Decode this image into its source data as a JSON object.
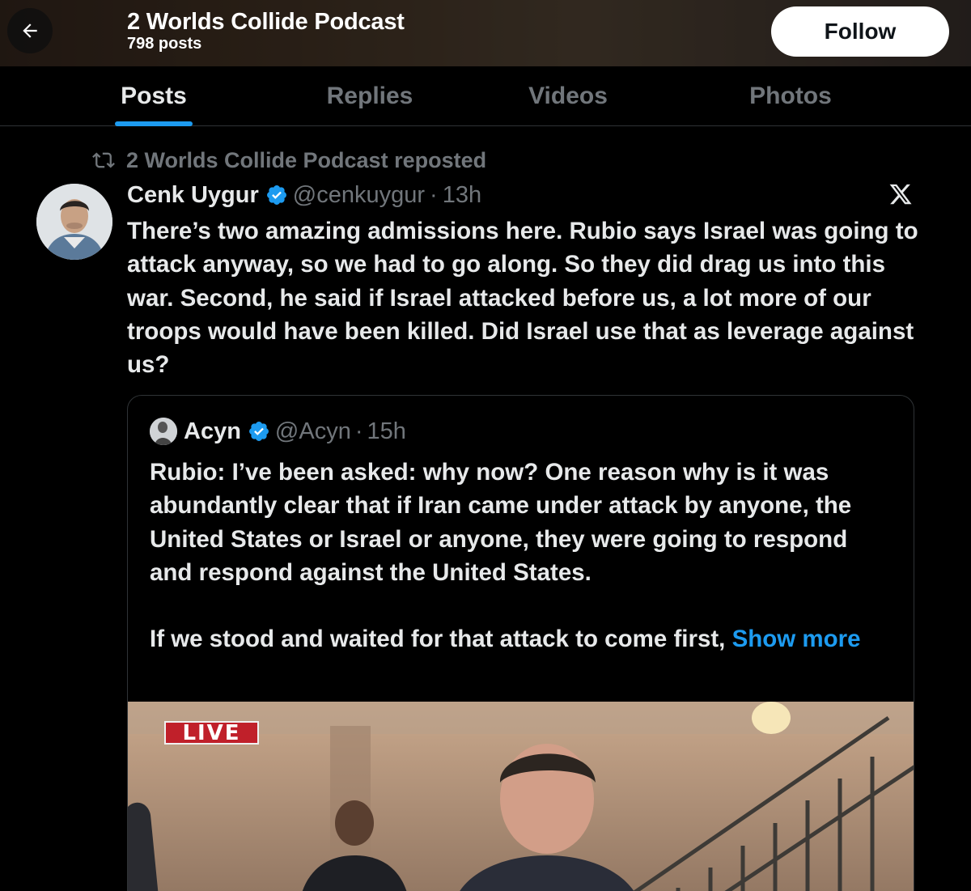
{
  "header": {
    "title": "2 Worlds Collide Podcast",
    "posts_count": "798 posts",
    "follow_label": "Follow"
  },
  "tabs": [
    {
      "label": "Posts",
      "active": true
    },
    {
      "label": "Replies",
      "active": false
    },
    {
      "label": "Videos",
      "active": false
    },
    {
      "label": "Photos",
      "active": false
    }
  ],
  "post": {
    "repost_label": "2 Worlds Collide Podcast reposted",
    "author_name": "Cenk Uygur",
    "handle": "@cenkuygur",
    "separator": "·",
    "time": "13h",
    "text": "There’s two amazing admissions here. Rubio says Israel was going to attack anyway, so we had to go along. So they did drag us into this war. Second, he said if Israel attacked before us, a lot more of our troops would have been killed. Did Israel use that as leverage against us?"
  },
  "quote": {
    "author_name": "Acyn",
    "handle": "@Acyn",
    "separator": "·",
    "time": "15h",
    "text": "Rubio: I’ve been asked: why now? One reason why is it was abundantly clear that if Iran came under attack by anyone, the United States or Israel or anyone, they were going to respond and respond against the United States.\n\nIf we stood and waited for that attack to come first, ",
    "show_more": "Show more",
    "media_badge": "LIVE"
  },
  "colors": {
    "background": "#000000",
    "text_primary": "#e7e9ea",
    "text_secondary": "#71767b",
    "accent": "#1d9bf0",
    "verified": "#1d9bf0",
    "live_badge": "#c0202a"
  },
  "icons": [
    "back-arrow-icon",
    "repost-icon",
    "verified-badge-icon",
    "x-logo-icon"
  ]
}
